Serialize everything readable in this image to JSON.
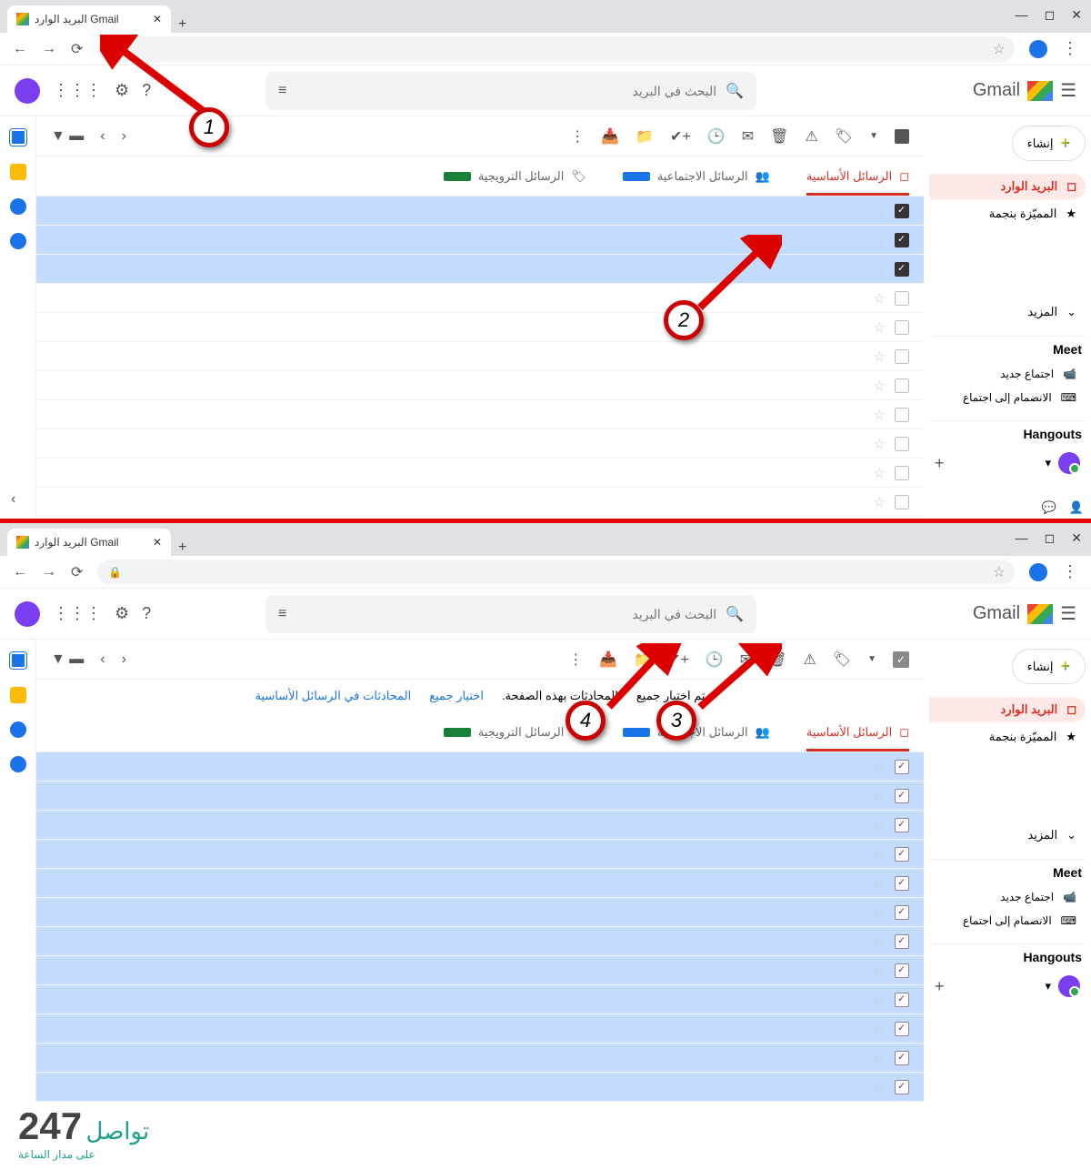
{
  "browser": {
    "tab_title": "البريد الوارد Gmail",
    "minimize": "—",
    "maximize": "◻",
    "close": "✕"
  },
  "header": {
    "brand": "Gmail",
    "search_placeholder": "البحث في البريد"
  },
  "toolbar_icons": [
    "archive",
    "move",
    "task",
    "snooze",
    "read",
    "delete",
    "spam",
    "label"
  ],
  "tabs": {
    "primary": "الرسائل الأساسية",
    "social": "الرسائل الاجتماعية",
    "promotions": "الرسائل الترويجية"
  },
  "sidebar": {
    "compose": "إنشاء",
    "inbox": "البريد الوارد",
    "starred": "المميّزة بنجمة",
    "more": "المزيد",
    "meet_title": "Meet",
    "meet_new": "اجتماع جديد",
    "meet_join": "الانضمام إلى اجتماع",
    "hangouts_title": "Hangouts"
  },
  "selection_bar": {
    "deselect": "تم اختيار جميع",
    "page": "المحادثات بهذه الصفحة.",
    "select_all": "اختيار جميع",
    "in_primary": "المحادثات في الرسائل الأساسية"
  },
  "markers": {
    "m1": "1",
    "m2": "2",
    "m3": "3",
    "m4": "4"
  },
  "watermark": {
    "num": "247",
    "ar": "تواصل",
    "sub": "على مدار الساعة"
  }
}
